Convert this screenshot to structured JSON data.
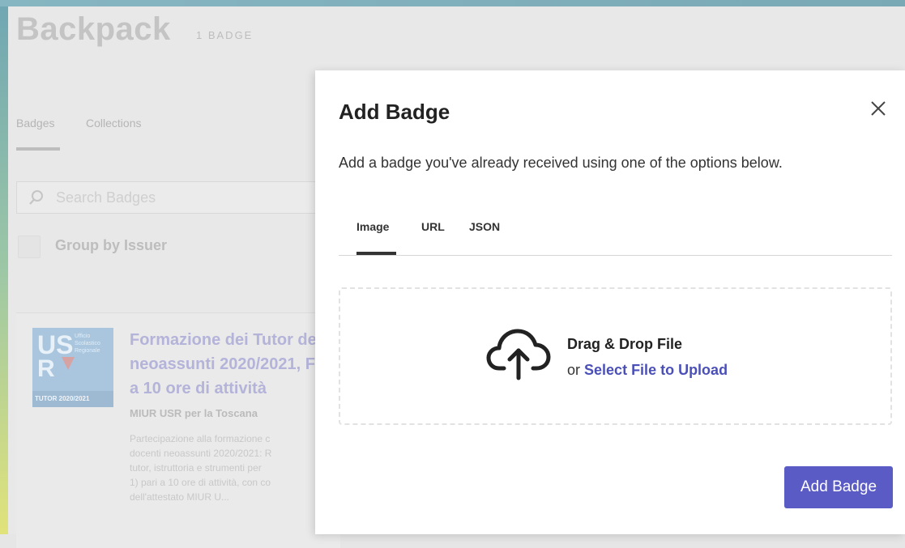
{
  "page": {
    "title": "Backpack",
    "badge_count": "1 BADGE",
    "tabs": [
      {
        "label": "Badges",
        "active": true
      },
      {
        "label": "Collections",
        "active": false
      }
    ],
    "search": {
      "placeholder": "Search Badges"
    },
    "group_by_issuer": {
      "label": "Group by Issuer",
      "checked": false
    }
  },
  "badge_card": {
    "image": {
      "logo_text": "USR",
      "side_text": "Ufficio\nScolastico\nRegionale",
      "bar_text": "TUTOR 2020/2021"
    },
    "title": "Formazione dei Tutor de\nneoassunti 2020/2021, F\na 10 ore di attività",
    "issuer": "MIUR USR per la Toscana",
    "description": "Partecipazione alla formazione c\ndocenti neoassunti 2020/2021: R\ntutor, istruttoria e strumenti per\n1) pari a 10 ore di attività, con co\ndell'attestato MIUR U..."
  },
  "modal": {
    "title": "Add Badge",
    "description": "Add a badge you've already received using one of the options below.",
    "tabs": [
      {
        "label": "Image",
        "active": true
      },
      {
        "label": "URL",
        "active": false
      },
      {
        "label": "JSON",
        "active": false
      }
    ],
    "dropzone": {
      "title": "Drag & Drop File",
      "or": "or",
      "select_link": "Select File to Upload"
    },
    "submit_label": "Add Badge"
  },
  "colors": {
    "accent": "#5b5bc6",
    "link": "#4b50b8"
  }
}
